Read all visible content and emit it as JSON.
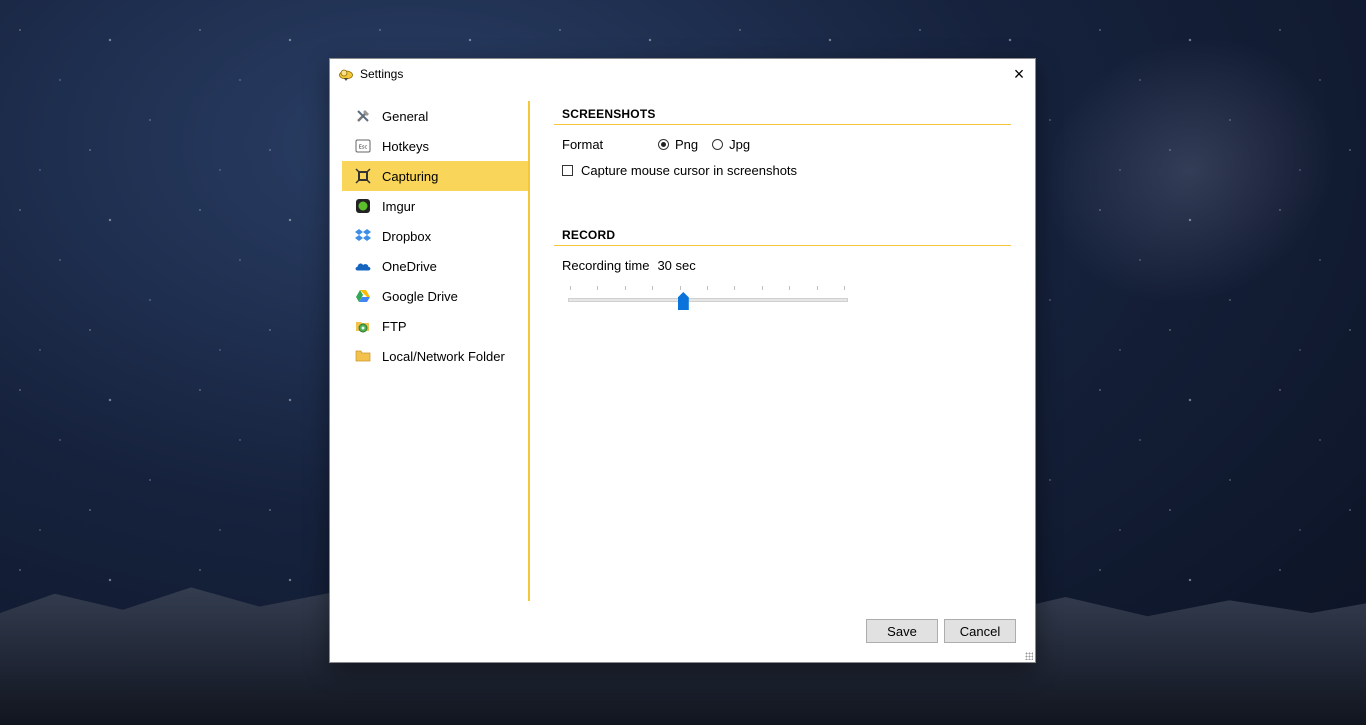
{
  "window": {
    "title": "Settings",
    "close_glyph": "×"
  },
  "sidebar": {
    "items": [
      {
        "label": "General",
        "icon": "tools-icon",
        "active": false
      },
      {
        "label": "Hotkeys",
        "icon": "esc-key-icon",
        "active": false
      },
      {
        "label": "Capturing",
        "icon": "capture-icon",
        "active": true
      },
      {
        "label": "Imgur",
        "icon": "imgur-icon",
        "active": false
      },
      {
        "label": "Dropbox",
        "icon": "dropbox-icon",
        "active": false
      },
      {
        "label": "OneDrive",
        "icon": "onedrive-icon",
        "active": false
      },
      {
        "label": "Google Drive",
        "icon": "google-drive-icon",
        "active": false
      },
      {
        "label": "FTP",
        "icon": "ftp-icon",
        "active": false
      },
      {
        "label": "Local/Network Folder",
        "icon": "folder-icon",
        "active": false
      }
    ]
  },
  "screenshots": {
    "heading": "SCREENSHOTS",
    "format_label": "Format",
    "formats": [
      {
        "label": "Png",
        "selected": true
      },
      {
        "label": "Jpg",
        "selected": false
      }
    ],
    "capture_cursor_label": "Capture mouse cursor in screenshots",
    "capture_cursor_checked": false
  },
  "record": {
    "heading": "RECORD",
    "recording_time_label": "Recording time",
    "recording_time_value": "30 sec",
    "slider_ticks": 11,
    "slider_position_fraction": 0.41
  },
  "buttons": {
    "save": "Save",
    "cancel": "Cancel"
  },
  "colors": {
    "accent": "#f4c73a",
    "active_item": "#f9d55a",
    "slider_thumb": "#0a74da"
  }
}
